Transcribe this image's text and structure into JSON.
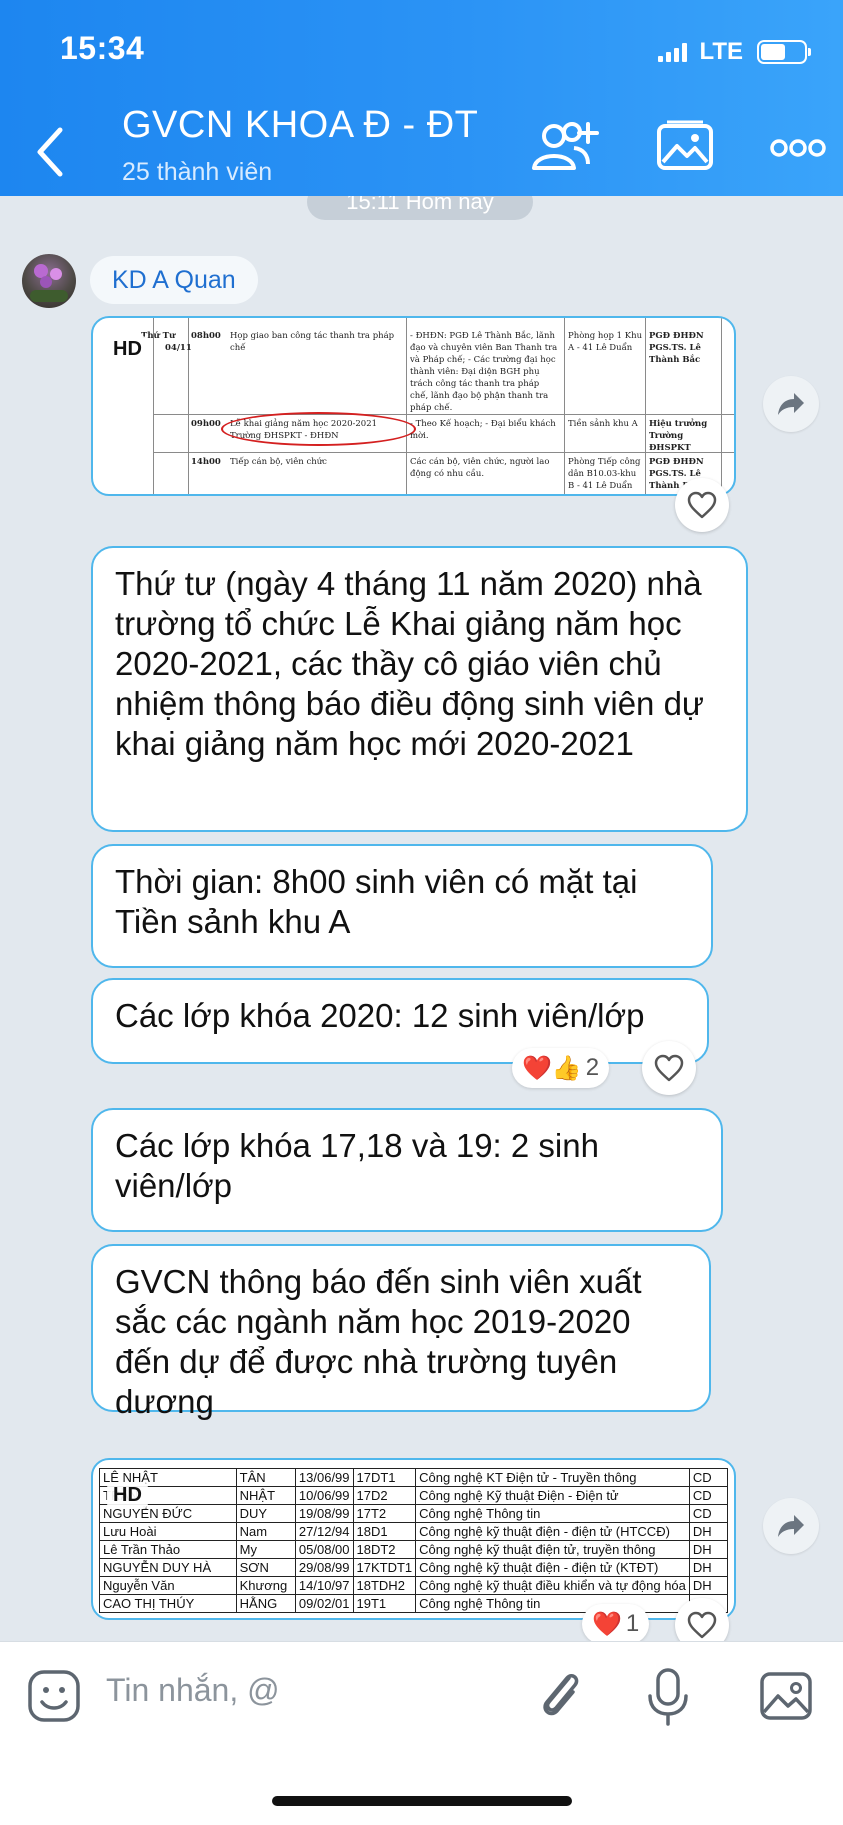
{
  "status_bar": {
    "time": "15:34",
    "network": "LTE",
    "battery_level": 0.45
  },
  "header": {
    "title": "GVCN KHOA Đ - ĐT",
    "subtitle": "25 thành viên",
    "icons": [
      "back-icon",
      "add-member-icon",
      "gallery-icon",
      "more-icon"
    ]
  },
  "chat": {
    "time_divider": "15:11 Hôm nay",
    "sender_name": "KD A Quan",
    "image1": {
      "badge": "HD",
      "rows": [
        {
          "day": "Thứ Tư",
          "date": "04/11",
          "time": "08h00",
          "content": "Họp giao ban công tác thanh tra pháp chế",
          "participants": "- ĐHĐN: PGĐ Lê Thành Bắc, lãnh đạo và chuyên viên Ban Thanh tra và Pháp chế; - Các trường đại học thành viên: Đại diện BGH phụ trách công tác thanh tra pháp chế, lãnh đạo bộ phận thanh tra pháp chế.",
          "location": "Phòng họp 1 Khu A - 41 Lê Duẩn",
          "chair": "PGĐ ĐHĐN PGS.TS. Lê Thành Bắc"
        },
        {
          "day": "",
          "date": "",
          "time": "09h00",
          "content": "Lễ khai giảng năm học 2020-2021 Trường ĐHSPKT - ĐHĐN",
          "participants": "- Theo Kế hoạch; - Đại biểu khách mời.",
          "location": "Tiền sảnh khu A",
          "chair": "Hiệu trưởng Trường ĐHSPKT"
        },
        {
          "day": "",
          "date": "",
          "time": "14h00",
          "content": "Tiếp cán bộ, viên chức",
          "participants": "Các cán bộ, viên chức, người lao động có nhu cầu.",
          "location": "Phòng Tiếp công dân B10.03-khu B - 41 Lê Duẩn",
          "chair": "PGĐ ĐHĐN PGS.TS. Lê Thành Bắc"
        }
      ]
    },
    "messages": [
      "Thứ tư (ngày 4 tháng 11 năm 2020) nhà trường tổ chức Lễ Khai giảng năm học 2020-2021, các thầy cô giáo viên chủ nhiệm thông báo điều động sinh viên dự khai giảng năm học mới 2020-2021",
      "Thời gian: 8h00 sinh viên có mặt tại Tiền sảnh khu A",
      "Các lớp khóa 2020: 12 sinh viên/lớp",
      "Các lớp khóa 17,18 và 19: 2 sinh viên/lớp",
      "GVCN thông báo đến sinh viên xuất sắc các ngành năm học 2019-2020 đến dự để được nhà trường tuyên dương"
    ],
    "reactions_msg3": {
      "emojis": "❤️👍",
      "count": "2"
    },
    "image2": {
      "badge": "HD",
      "rows": [
        [
          "LÊ NHẬT",
          "TÂN",
          "13/06/99",
          "17DT1",
          "Công nghệ KT Điện tử - Truyền thông",
          "CD"
        ],
        [
          "TRẦN",
          "NHẬT",
          "10/06/99",
          "17D2",
          "Công nghệ Kỹ thuật Điện - Điện tử",
          "CD"
        ],
        [
          "NGUYỄN ĐỨC",
          "DUY",
          "19/08/99",
          "17T2",
          "Công nghệ Thông tin",
          "CD"
        ],
        [
          "Lưu Hoài",
          "Nam",
          "27/12/94",
          "18D1",
          "Công nghệ kỹ thuật điện - điện tử (HTCCĐ)",
          "DH"
        ],
        [
          "Lê Trần Thảo",
          "My",
          "05/08/00",
          "18DT2",
          "Công nghệ kỹ thuật điện tử, truyền thông",
          "DH"
        ],
        [
          "NGUYỄN DUY HÀ",
          "SƠN",
          "29/08/99",
          "17KTDT1",
          "Công nghệ kỹ thuật điện - điện tử (KTĐT)",
          "DH"
        ],
        [
          "Nguyễn Văn",
          "Khương",
          "14/10/97",
          "18TDH2",
          "Công nghệ kỹ thuật điều khiển và tự động hóa",
          "DH"
        ],
        [
          "CAO THỊ THÚY",
          "HẰNG",
          "09/02/01",
          "19T1",
          "Công nghệ Thông tin",
          ""
        ]
      ]
    },
    "reactions_img2": {
      "emojis": "❤️",
      "count": "1"
    }
  },
  "input_bar": {
    "placeholder": "Tin nhắn, @"
  },
  "colors": {
    "header": "#2b93f5",
    "bubble_border": "#4fb7ec",
    "background": "#e2e8ee"
  }
}
